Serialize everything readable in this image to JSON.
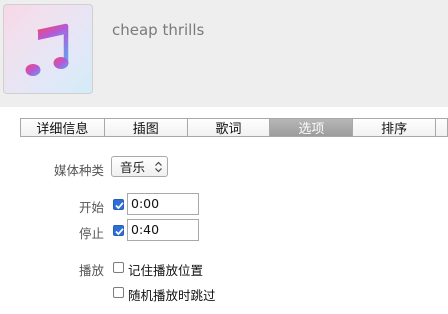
{
  "header": {
    "title": "cheap thrills",
    "art_icon": "music-note-icon"
  },
  "tabs": [
    {
      "label": "详细信息",
      "active": false
    },
    {
      "label": "插图",
      "active": false
    },
    {
      "label": "歌词",
      "active": false
    },
    {
      "label": "选项",
      "active": true
    },
    {
      "label": "排序",
      "active": false
    },
    {
      "label": "",
      "active": false
    }
  ],
  "options": {
    "media_kind_label": "媒体种类",
    "media_kind_value": "音乐",
    "start_label": "开始",
    "start_checked": true,
    "start_value": "0:00",
    "stop_label": "停止",
    "stop_checked": true,
    "stop_value": "0:40",
    "playback_label": "播放",
    "remember_position": "记住播放位置",
    "remember_checked": false,
    "skip_shuffle": "随机播放时跳过",
    "skip_checked": false
  },
  "colors": {
    "accent": "#2d6fd4",
    "header_bg": "#eeeeee"
  }
}
